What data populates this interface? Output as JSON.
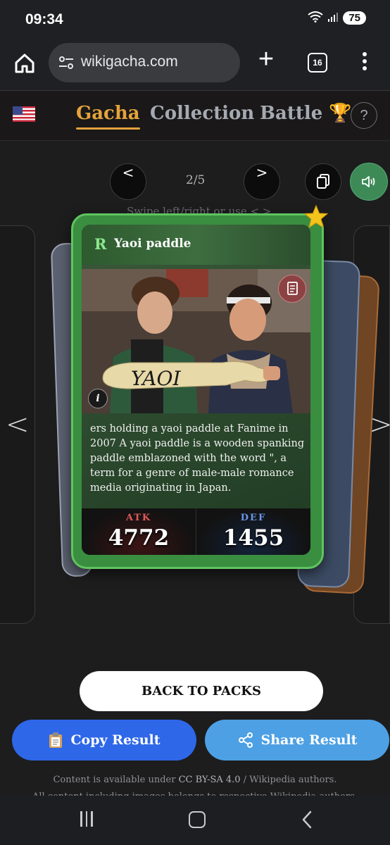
{
  "status_bar": {
    "time": "09:34",
    "battery": "75"
  },
  "browser": {
    "url": "wikigacha.com",
    "tab_count": "16"
  },
  "nav": {
    "gacha": "Gacha",
    "collection": "Collection",
    "battle": "Battle",
    "help": "?"
  },
  "pager": {
    "prev": "<",
    "next": ">",
    "counter": "2/5",
    "swipe_hint": "Swipe left/right or use < >"
  },
  "side_arrows": {
    "left": "<",
    "right": ">"
  },
  "card": {
    "rarity": "R",
    "title": "Yaoi paddle",
    "photo_text": "YAOI",
    "description": "ers holding a yaoi paddle at Fanime in 2007 A yaoi paddle is a wooden spanking paddle emblazoned with the word \", a term for a genre of male-male romance media originating in Japan.",
    "atk_label": "ATK",
    "atk_value": "4772",
    "def_label": "DEF",
    "def_value": "1455",
    "info_label": "i"
  },
  "buttons": {
    "back": "BACK TO PACKS",
    "copy": "Copy Result",
    "share": "Share Result"
  },
  "footer": {
    "prefix": "Content is available under",
    "license": "CC BY-SA 4.0",
    "suffix": "/ Wikipedia authors.",
    "line2": "All content including images belongs to respective Wikipedia authors."
  },
  "colors": {
    "accent": "#e4a33c",
    "card_green": "#3a8e40",
    "copy_blue": "#2e67e8",
    "share_blue": "#4da0e4"
  }
}
